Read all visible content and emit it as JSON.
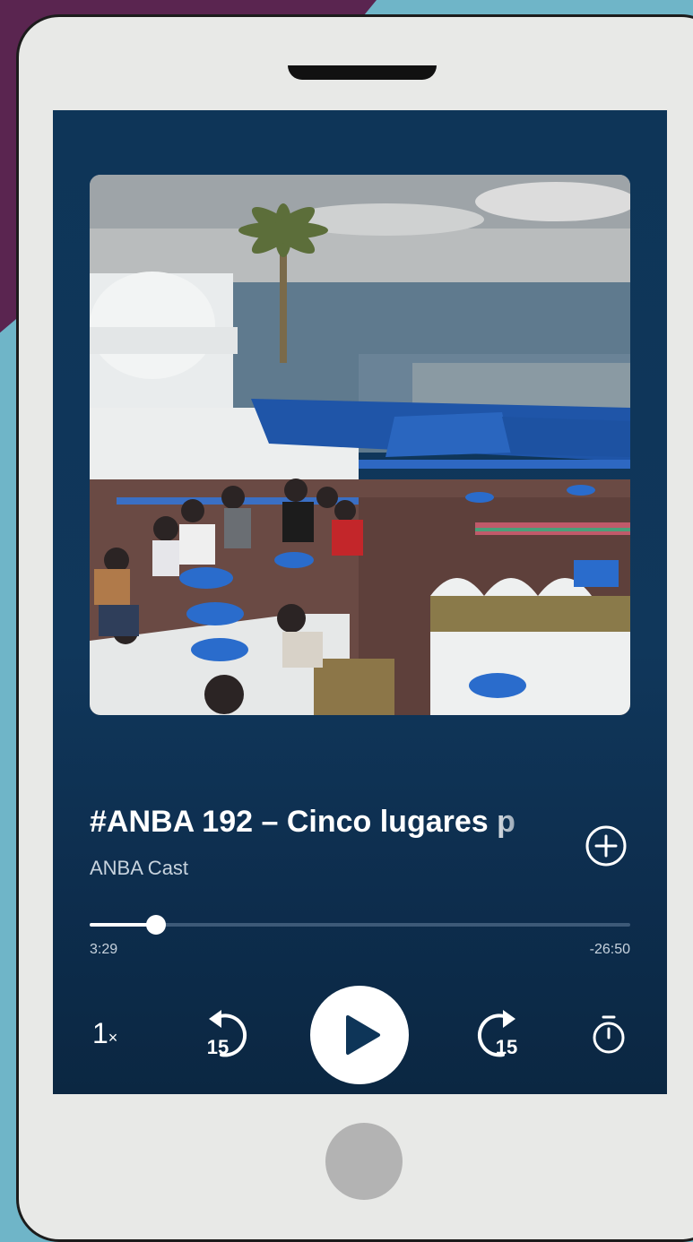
{
  "player": {
    "episode_title": "#ANBA 192 – Cinco lugares p",
    "show_name": "ANBA Cast",
    "progress_fraction": 0.122,
    "time_elapsed": "3:29",
    "time_remaining": "-26:50",
    "speed_value": "1",
    "speed_suffix": "×",
    "skip_back_seconds": "15",
    "skip_forward_seconds": "15"
  },
  "colors": {
    "screen_bg": "#0e3558",
    "accent": "#ffffff",
    "muted_text": "#c7d3de",
    "track": "#3d5a78"
  },
  "icons": {
    "add": "plus-circle-icon",
    "rewind": "rewind-15-icon",
    "play": "play-icon",
    "forward": "forward-15-icon",
    "timer": "sleep-timer-icon"
  }
}
